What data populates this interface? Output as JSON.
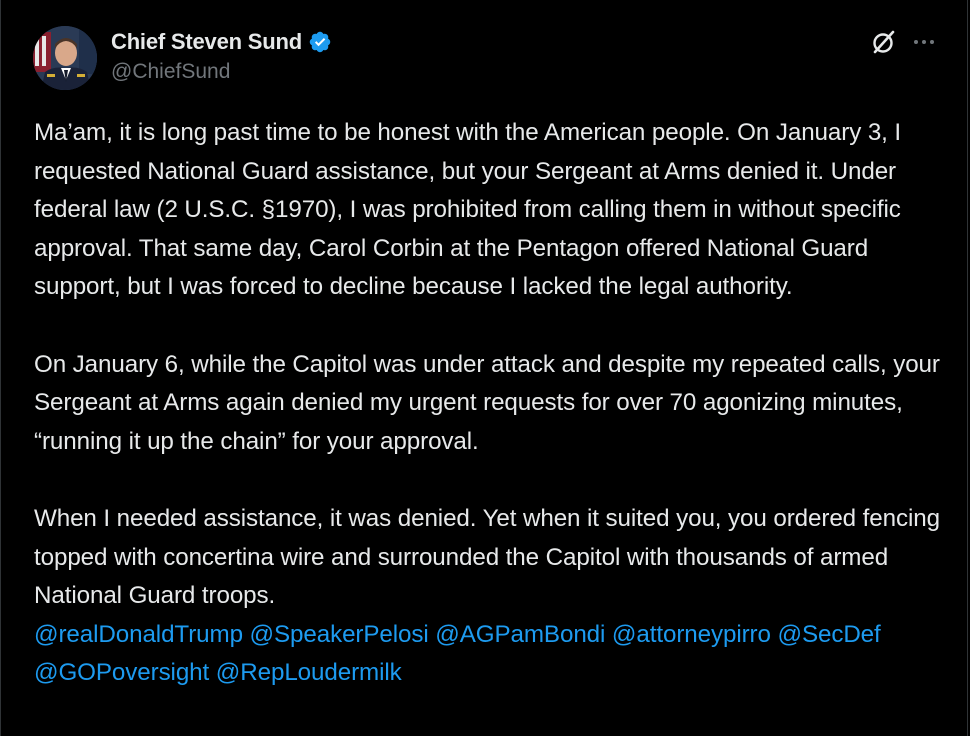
{
  "author": {
    "display_name": "Chief Steven Sund",
    "handle": "@ChiefSund",
    "verified": true
  },
  "icons": {
    "verified": "verified-badge-icon",
    "grok": "grok-icon",
    "more": "more-options-icon"
  },
  "colors": {
    "background": "#000000",
    "text": "#e7e9ea",
    "secondary_text": "#71767b",
    "link": "#1d9bf0",
    "verified_badge": "#1d9bf0"
  },
  "post": {
    "paragraph_1": "Ma’am, it is long past time to be honest with the American people. On January 3, I requested National Guard assistance, but your Sergeant at Arms denied it. Under federal law (2 U.S.C. §1970), I was prohibited from calling them in without specific approval. That same day, Carol Corbin at the Pentagon offered National Guard support, but I was forced to decline because I lacked the legal authority.",
    "paragraph_2": "On January 6, while the Capitol was under attack and despite my repeated calls, your Sergeant at Arms again denied my urgent requests for over 70 agonizing minutes, “running it up the chain” for your approval.",
    "paragraph_3": "When I needed assistance, it was denied. Yet when it suited you, you ordered fencing topped with concertina wire and surrounded the Capitol with thousands of armed National Guard troops.",
    "mentions": [
      "@realDonaldTrump",
      "@SpeakerPelosi",
      "@AGPamBondi",
      "@attorneypirro",
      "@SecDef",
      "@GOPoversight",
      "@RepLoudermilk"
    ]
  }
}
